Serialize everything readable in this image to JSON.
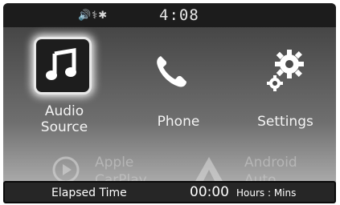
{
  "status_bar": {
    "icons": "🔊⚕✱",
    "time": "4:08"
  },
  "tiles": {
    "audio": {
      "label_line1": "Audio",
      "label_line2": "Source",
      "icon": "music-note-icon"
    },
    "phone": {
      "label": "Phone",
      "icon": "phone-icon"
    },
    "settings": {
      "label": "Settings",
      "icon": "gear-icon"
    }
  },
  "faded_row": {
    "apple": {
      "line1": "Apple",
      "line2": "CarPlay",
      "icon": "play-circle-icon"
    },
    "android": {
      "line1": "Android",
      "line2": "Auto",
      "icon": "android-auto-icon"
    }
  },
  "elapsed": {
    "label": "Elapsed Time",
    "value": "00:00",
    "unit": "Hours : Mins"
  }
}
